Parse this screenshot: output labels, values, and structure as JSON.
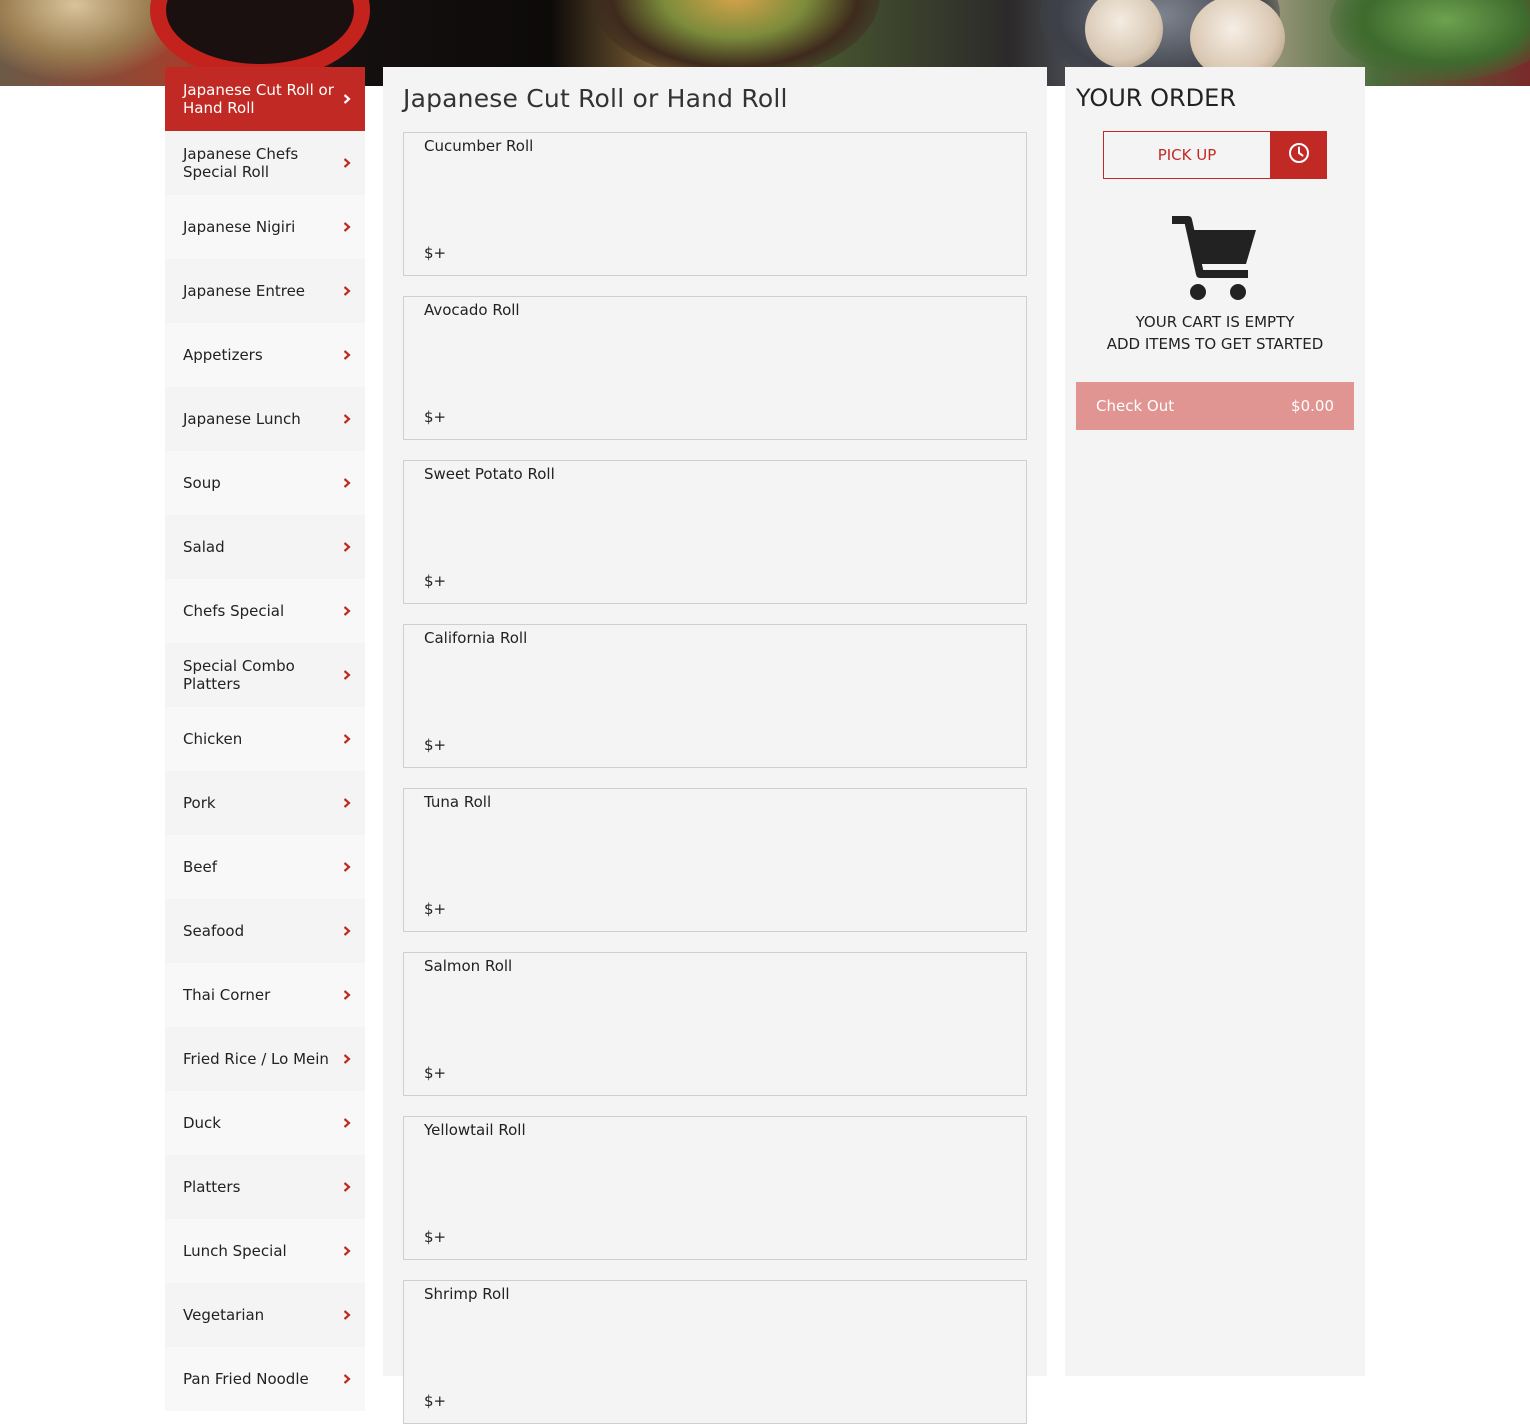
{
  "sidebar": {
    "items": [
      {
        "label": "Japanese Cut Roll or Hand Roll",
        "active": true
      },
      {
        "label": "Japanese Chefs Special Roll"
      },
      {
        "label": "Japanese Nigiri"
      },
      {
        "label": "Japanese Entree"
      },
      {
        "label": "Appetizers"
      },
      {
        "label": "Japanese Lunch"
      },
      {
        "label": "Soup"
      },
      {
        "label": "Salad"
      },
      {
        "label": "Chefs Special"
      },
      {
        "label": "Special Combo Platters"
      },
      {
        "label": "Chicken"
      },
      {
        "label": "Pork"
      },
      {
        "label": "Beef"
      },
      {
        "label": "Seafood"
      },
      {
        "label": "Thai Corner"
      },
      {
        "label": "Fried Rice / Lo Mein"
      },
      {
        "label": "Duck"
      },
      {
        "label": "Platters"
      },
      {
        "label": "Lunch Special"
      },
      {
        "label": "Vegetarian"
      },
      {
        "label": "Pan Fried Noodle"
      }
    ]
  },
  "main": {
    "title": "Japanese Cut Roll or Hand Roll",
    "items": [
      {
        "name": "Cucumber Roll",
        "price": "$+"
      },
      {
        "name": "Avocado Roll",
        "price": "$+"
      },
      {
        "name": "Sweet Potato Roll",
        "price": "$+"
      },
      {
        "name": "California Roll",
        "price": "$+"
      },
      {
        "name": "Tuna Roll",
        "price": "$+"
      },
      {
        "name": "Salmon Roll",
        "price": "$+"
      },
      {
        "name": "Yellowtail Roll",
        "price": "$+"
      },
      {
        "name": "Shrimp Roll",
        "price": "$+"
      }
    ]
  },
  "order": {
    "title": "YOUR ORDER",
    "pickup_label": "PICK UP",
    "empty_line1": "YOUR CART IS EMPTY",
    "empty_line2": "ADD ITEMS TO GET STARTED",
    "checkout_label": "Check Out",
    "checkout_total": "$0.00"
  },
  "icons": {
    "chevron": "chevron-right-icon",
    "clock": "clock-icon",
    "cart": "shopping-cart-icon"
  },
  "colors": {
    "accent": "#c12a24",
    "checkout_disabled": "#e09593",
    "panel": "#f4f4f4"
  }
}
